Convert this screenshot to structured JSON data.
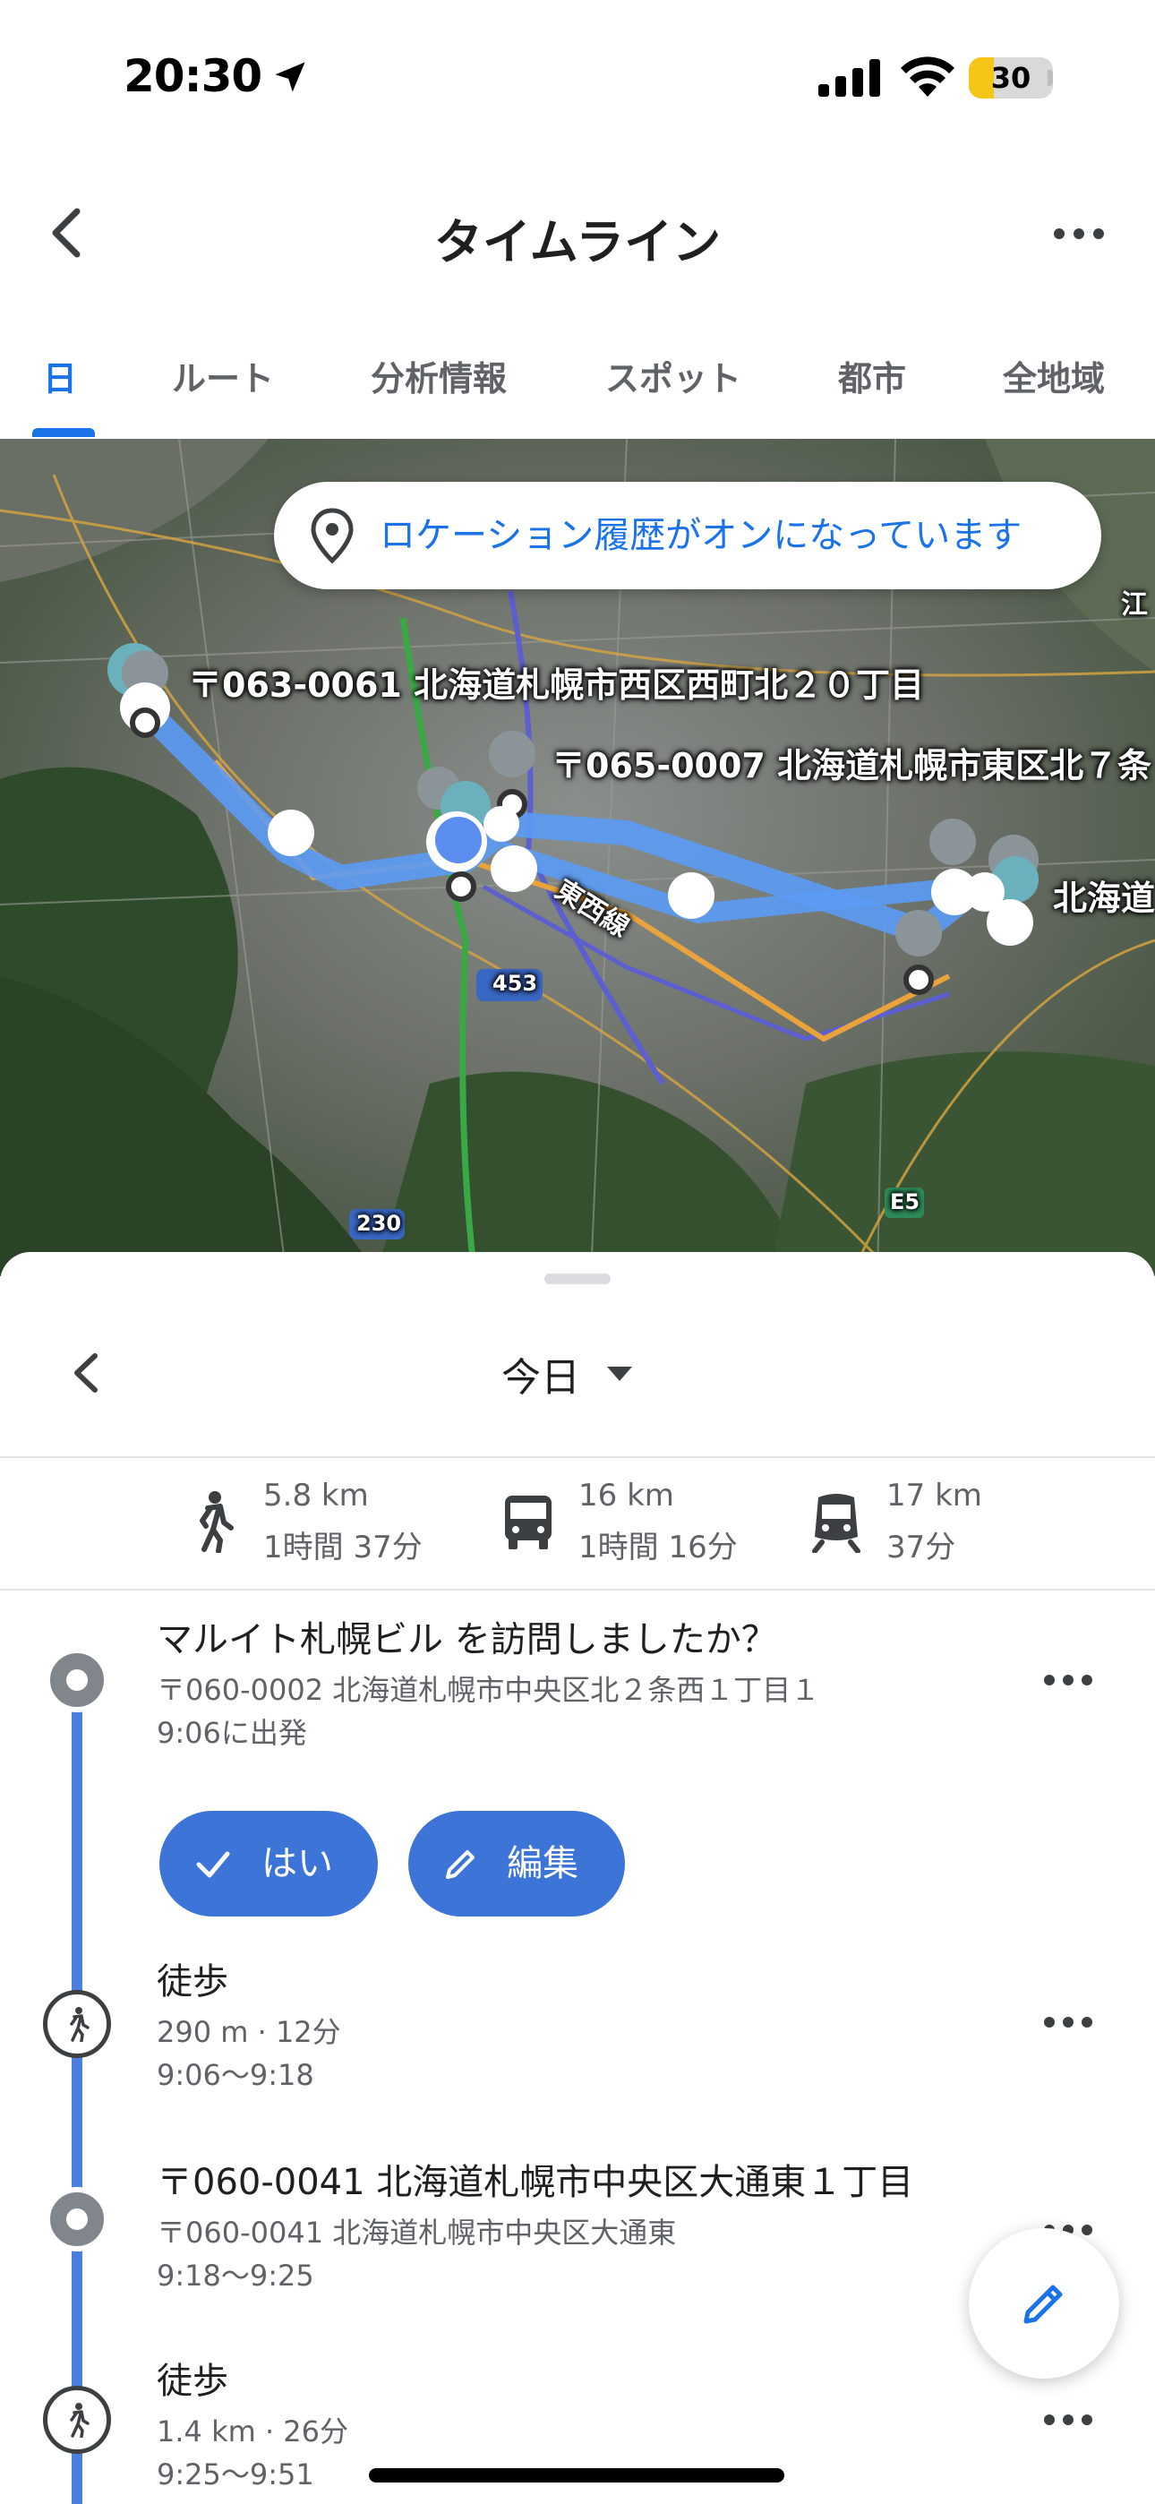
{
  "status_bar": {
    "time": "20:30",
    "battery": "30",
    "battery_level": 0.3,
    "icons": [
      "location-arrow-icon",
      "signal-icon",
      "wifi-icon",
      "battery-icon"
    ]
  },
  "header": {
    "title": "タイムライン",
    "back_icon": "chevron-left-icon",
    "more_icon": "more-horizontal-icon"
  },
  "tabs": [
    {
      "label": "日",
      "active": true
    },
    {
      "label": "ルート",
      "active": false
    },
    {
      "label": "分析情報",
      "active": false
    },
    {
      "label": "スポット",
      "active": false
    },
    {
      "label": "都市",
      "active": false
    },
    {
      "label": "全地域",
      "active": false
    }
  ],
  "map": {
    "banner": "ロケーション履歴がオンになっています",
    "labels": {
      "place1": "〒063-0061 北海道札幌市西区西町北２０丁目",
      "place2": "〒065-0007 北海道札幌市東区北７条",
      "place3": "北海道",
      "line_name": "東西線",
      "corner": "江",
      "road_453": "453",
      "road_230": "230",
      "road_e5": "E5"
    },
    "colors": {
      "route": "#5b9bf5",
      "orange_line": "#e8a33c",
      "green_line": "#3aa845",
      "purple_line": "#5b5fcf"
    }
  },
  "sheet": {
    "date": "今日",
    "stats": [
      {
        "icon": "walking-icon",
        "distance": "5.8 km",
        "duration": "1時間 37分"
      },
      {
        "icon": "bus-icon",
        "distance": "16 km",
        "duration": "1時間 16分"
      },
      {
        "icon": "train-icon",
        "distance": "17 km",
        "duration": "37分"
      }
    ],
    "timeline": [
      {
        "type": "visit",
        "title": "マルイト札幌ビル を訪問しましたか？",
        "address": "〒060-0002 北海道札幌市中央区北２条西１丁目１",
        "time": "9:06に出発",
        "yes_label": "はい",
        "edit_label": "編集"
      },
      {
        "type": "walk",
        "title": "徒歩",
        "detail": "290 m · 12分",
        "time": "9:06〜9:18"
      },
      {
        "type": "visit",
        "title": "〒060-0041 北海道札幌市中央区大通東１丁目",
        "address": "〒060-0041 北海道札幌市中央区大通東",
        "time": "9:18〜9:25"
      },
      {
        "type": "walk",
        "title": "徒歩",
        "detail": "1.4 km · 26分",
        "time": "9:25〜9:51"
      }
    ],
    "colors": {
      "timeline": "#4a7fe0",
      "button": "#3c74d8"
    }
  }
}
